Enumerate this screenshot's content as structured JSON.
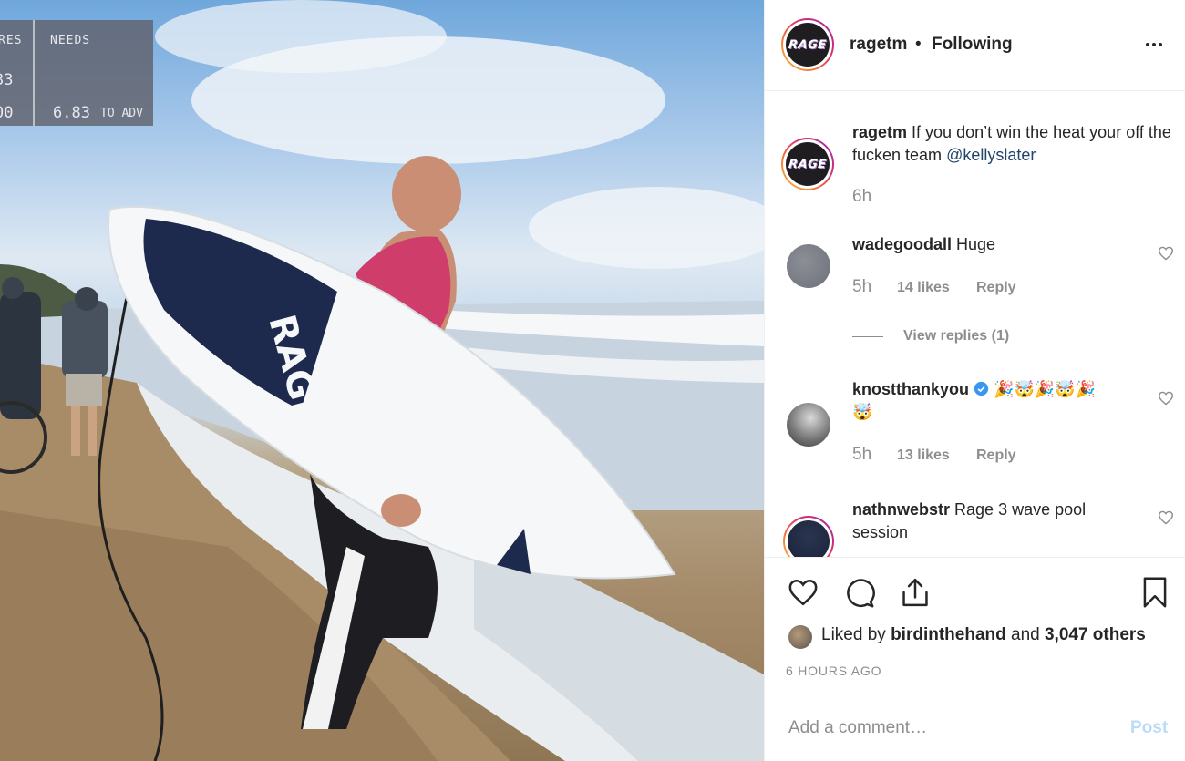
{
  "media": {
    "scoreboard": {
      "col1_header": "RES",
      "col1_values": [
        "33",
        "00"
      ],
      "col2_header": "NEEDS",
      "needs_value": "6.83",
      "needs_suffix": "TO ADV"
    },
    "board_text": "RAGE"
  },
  "header": {
    "avatar_text": "RAGE",
    "username": "ragetm",
    "separator": "•",
    "follow_status": "Following"
  },
  "caption": {
    "username": "ragetm",
    "text": "If you don’t win the heat your off the fucken team",
    "mention": "@kellyslater",
    "time": "6h"
  },
  "comments": [
    {
      "username": "wadegoodall",
      "text": "Huge",
      "time": "5h",
      "likes": "14 likes",
      "reply": "Reply",
      "view_replies": "View replies (1)"
    },
    {
      "username": "knostthankyou",
      "verified": true,
      "emoji_line1": "🎉🤯🎉🤯🎉",
      "emoji_line2": "🤯",
      "time": "5h",
      "likes": "13 likes",
      "reply": "Reply"
    },
    {
      "username": "nathnwebstr",
      "text_line1": "Rage 3 wave pool",
      "text_line2": "session"
    }
  ],
  "likes": {
    "prefix": "Liked by",
    "user": "birdinthehand",
    "conj": "and",
    "others": "3,047 others"
  },
  "timestamp": "6 HOURS AGO",
  "comment_box": {
    "placeholder": "Add a comment…",
    "post_label": "Post"
  },
  "colors": {
    "post_disabled": "#b9dcf9",
    "mention": "#22446b",
    "muted": "#8e8e8e"
  }
}
